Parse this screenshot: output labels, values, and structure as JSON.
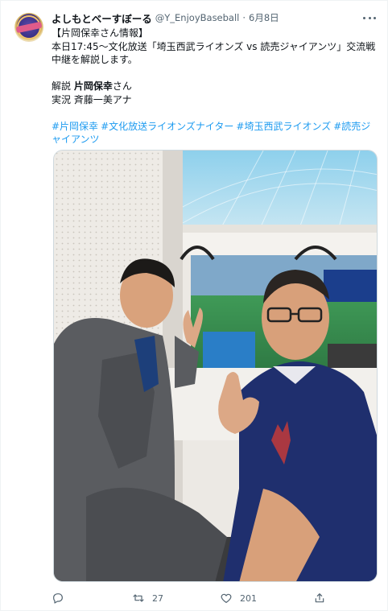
{
  "tweet": {
    "display_name": "よしもとベーすぼーる",
    "handle": "@Y_EnjoyBaseball",
    "separator": "·",
    "date": "6月8日",
    "avatar_icon": "avatar-logo",
    "lines": [
      "【片岡保幸さん情報】",
      "本日17:45～文化放送「埼玉西武ライオンズ vs 読売ジャイアンツ」交流戦",
      "中継を解説します。"
    ],
    "credits": [
      {
        "role": "解説",
        "name": "片岡保幸",
        "suffix": "さん"
      },
      {
        "role": "実況",
        "name": "斉藤一美アナ",
        "suffix": ""
      }
    ],
    "hashtags": [
      "#片岡保幸",
      "#文化放送ライオンズナイター",
      "#埼玉西武ライオンズ",
      "#読売ジャイアンツ"
    ],
    "hashtag_color": "#1d9bf0"
  },
  "actions": {
    "reply": {
      "icon": "reply-icon",
      "count": ""
    },
    "retweet": {
      "icon": "retweet-icon",
      "count": "27"
    },
    "like": {
      "icon": "like-icon",
      "count": "201"
    },
    "share": {
      "icon": "share-icon",
      "count": ""
    }
  }
}
